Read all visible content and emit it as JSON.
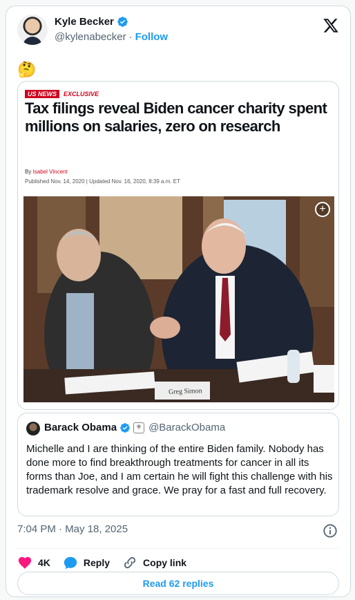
{
  "author": {
    "name": "Kyle Becker",
    "handle": "@kylenabecker",
    "follow_label": "Follow",
    "verified_color": "#1d9bf0"
  },
  "post": {
    "emoji": "🤔",
    "timestamp": "7:04 PM · May 18, 2025"
  },
  "article": {
    "section_tag": "US NEWS",
    "exclusive_tag": "EXCLUSIVE",
    "headline": "Tax filings reveal Biden cancer charity spent millions on salaries, zero on research",
    "by_prefix": "By",
    "byline_author": "Isabel Vincent",
    "dates": "Published Nov. 14, 2020 | Updated Nov. 16, 2020, 8:39 a.m. ET",
    "image_caption_placard": "Greg Simon",
    "accent_color": "#d0021b"
  },
  "quote": {
    "name": "Barack Obama",
    "handle": "@BarackObama",
    "text": "Michelle and I are thinking of the entire Biden family. Nobody has done more to find breakthrough treatments for cancer in all its forms than Joe, and I am certain he will fight this challenge with his trademark resolve and grace. We pray for a fast and full recovery."
  },
  "actions": {
    "like_count": "4K",
    "reply_label": "Reply",
    "copy_link_label": "Copy link",
    "read_replies_label": "Read 62 replies"
  },
  "icons": [
    "verified-badge-icon",
    "x-logo-icon",
    "plus-icon",
    "info-icon",
    "heart-icon",
    "reply-bubble-icon",
    "link-icon"
  ]
}
